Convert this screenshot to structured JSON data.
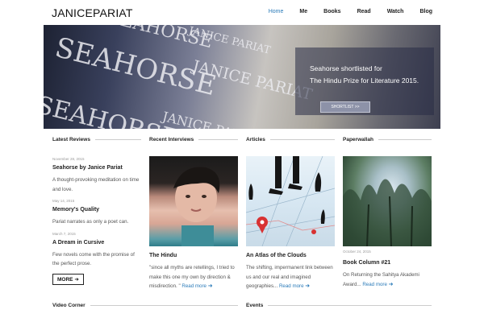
{
  "header": {
    "logo": "JANICEPARIAT",
    "nav": [
      "Home",
      "Me",
      "Books",
      "Read",
      "Watch",
      "Blog"
    ]
  },
  "hero": {
    "book_words": [
      "SEAHORSE",
      "JANICE PARIAT",
      "SEAHORSE",
      "JANICE PARIAT",
      "SEAHORSE",
      "JANICE PARIAT"
    ],
    "overlay_title": "Seahorse shortlisted for",
    "overlay_sub": "The Hindu Prize for Literature 2015.",
    "overlay_button": "SHORTLIST >>"
  },
  "reviews": {
    "title": "Latest Reviews",
    "items": [
      {
        "date": "November 28, 2015",
        "title": "Seahorse by Janice Pariat",
        "text": "A thought-provoking meditation on time and love."
      },
      {
        "date": "May 14, 2015",
        "title": "Memory's Quality",
        "text": "Pariat narrates as only a poet can."
      },
      {
        "date": "March 7, 2015",
        "title": "A Dream in Cursive",
        "text": "Few novels come with the promise of the perfect prose."
      }
    ],
    "more_button": "MORE"
  },
  "interviews": {
    "title": "Recent Interviews",
    "card_title": "The Hindu",
    "text": "\"since all myths are retellings, I tried to make this one my own by direction & misdirection. \"",
    "read_more": "Read more"
  },
  "articles": {
    "title": "Articles",
    "card_title": "An Atlas of the Clouds",
    "text": "The shifting, impermanent link between us and our real and imagined geographies...",
    "read_more": "Read more"
  },
  "paperwallah": {
    "title": "Paperwallah",
    "date": "October 24, 2015",
    "card_title": "Book Column #21",
    "text": "On Returning the Sahitya Akademi Award...",
    "read_more": "Read more"
  },
  "bottom": {
    "video": "Video Corner",
    "events": "Events"
  },
  "colors": {
    "accent": "#2b7bb9"
  }
}
